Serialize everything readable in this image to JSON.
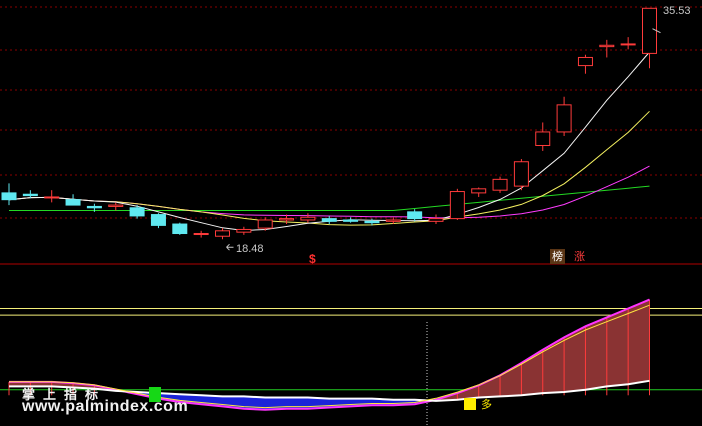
{
  "chart_data": [
    {
      "type": "candlestick",
      "panel": "main",
      "annotations": {
        "high_label": "35.53",
        "low_label": "18.48",
        "marker": "$"
      },
      "candles": [
        {
          "o": 21.9,
          "h": 22.6,
          "l": 21.0,
          "c": 21.4
        },
        {
          "o": 21.8,
          "h": 22.1,
          "l": 21.5,
          "c": 21.7
        },
        {
          "o": 21.6,
          "h": 22.1,
          "l": 21.2,
          "c": 21.6
        },
        {
          "o": 21.4,
          "h": 21.8,
          "l": 21.0,
          "c": 21.0
        },
        {
          "o": 20.9,
          "h": 21.1,
          "l": 20.5,
          "c": 20.8
        },
        {
          "o": 20.9,
          "h": 21.2,
          "l": 20.6,
          "c": 21.0
        },
        {
          "o": 20.8,
          "h": 21.0,
          "l": 20.0,
          "c": 20.2
        },
        {
          "o": 20.3,
          "h": 20.4,
          "l": 19.3,
          "c": 19.5
        },
        {
          "o": 19.6,
          "h": 19.7,
          "l": 18.8,
          "c": 18.9
        },
        {
          "o": 18.9,
          "h": 19.1,
          "l": 18.6,
          "c": 18.9
        },
        {
          "o": 18.7,
          "h": 19.3,
          "l": 18.48,
          "c": 19.1
        },
        {
          "o": 19.0,
          "h": 19.4,
          "l": 18.8,
          "c": 19.2
        },
        {
          "o": 19.3,
          "h": 20.1,
          "l": 19.1,
          "c": 19.9
        },
        {
          "o": 19.9,
          "h": 20.3,
          "l": 19.6,
          "c": 20.0
        },
        {
          "o": 19.9,
          "h": 20.4,
          "l": 19.7,
          "c": 20.1
        },
        {
          "o": 20.0,
          "h": 20.2,
          "l": 19.6,
          "c": 19.8
        },
        {
          "o": 19.9,
          "h": 20.1,
          "l": 19.7,
          "c": 19.8
        },
        {
          "o": 19.8,
          "h": 20.0,
          "l": 19.5,
          "c": 19.7
        },
        {
          "o": 19.8,
          "h": 20.1,
          "l": 19.6,
          "c": 19.9
        },
        {
          "o": 20.5,
          "h": 20.7,
          "l": 19.8,
          "c": 20.0
        },
        {
          "o": 19.8,
          "h": 20.3,
          "l": 19.6,
          "c": 20.0
        },
        {
          "o": 20.0,
          "h": 22.2,
          "l": 19.9,
          "c": 22.0
        },
        {
          "o": 21.9,
          "h": 22.3,
          "l": 21.6,
          "c": 22.2
        },
        {
          "o": 22.1,
          "h": 23.1,
          "l": 21.9,
          "c": 22.9
        },
        {
          "o": 22.4,
          "h": 24.4,
          "l": 22.1,
          "c": 24.2
        },
        {
          "o": 25.4,
          "h": 27.1,
          "l": 25.0,
          "c": 26.4
        },
        {
          "o": 26.4,
          "h": 29.0,
          "l": 26.1,
          "c": 28.4
        },
        {
          "o": 31.3,
          "h": 32.1,
          "l": 30.7,
          "c": 31.9
        },
        {
          "o": 32.7,
          "h": 33.2,
          "l": 31.9,
          "c": 32.8
        },
        {
          "o": 32.9,
          "h": 33.4,
          "l": 32.5,
          "c": 32.9
        },
        {
          "o": 32.2,
          "h": 34.1,
          "l": 31.1,
          "c": 35.53
        }
      ]
    },
    {
      "type": "area",
      "panel": "indicator",
      "levels": [
        0.78,
        0.72,
        0.05
      ],
      "series": [
        {
          "values": [
            0.12,
            0.12,
            0.12,
            0.11,
            0.09,
            0.05,
            0.01,
            -0.03,
            -0.06,
            -0.08,
            -0.1,
            -0.12,
            -0.13,
            -0.12,
            -0.12,
            -0.11,
            -0.1,
            -0.09,
            -0.09,
            -0.08,
            -0.04,
            0.02,
            0.09,
            0.18,
            0.29,
            0.41,
            0.52,
            0.62,
            0.7,
            0.78,
            0.86
          ]
        },
        {
          "values": [
            0.08,
            0.08,
            0.08,
            0.07,
            0.06,
            0.04,
            0.03,
            0.02,
            0.01,
            0.0,
            -0.01,
            -0.01,
            -0.02,
            -0.02,
            -0.02,
            -0.03,
            -0.03,
            -0.03,
            -0.04,
            -0.04,
            -0.05,
            -0.04,
            -0.02,
            -0.01,
            0.0,
            0.02,
            0.03,
            0.05,
            0.08,
            0.1,
            0.13
          ]
        },
        {
          "values": [
            0.79,
            0.8,
            0.8,
            0.81,
            0.81,
            0.82,
            0.82,
            0.83,
            0.83,
            0.84,
            0.84,
            0.85,
            0.85,
            0.86,
            0.86,
            0.87,
            0.87,
            0.88,
            0.88,
            0.89,
            0.89,
            0.9,
            0.9,
            0.91,
            0.91,
            0.92,
            0.92,
            0.93,
            0.93,
            0.94,
            0.94
          ]
        }
      ]
    }
  ],
  "badges": [
    {
      "text": "榜",
      "color": "#ffffff",
      "bg": "#5a3515"
    },
    {
      "text": "涨",
      "color": "#ff3c3c",
      "bg": "#000000"
    }
  ],
  "watermark": {
    "line1": "掌上指标",
    "line2": "www.palmindex.com"
  },
  "signal": {
    "text": "多"
  },
  "colors": {
    "up": "#ff3b3b",
    "down": "#5fe8f0",
    "ma5": "#f4f4f4",
    "ma10": "#f4f060",
    "ma20": "#ff3cff",
    "ma60": "#23d923",
    "grid": "#8a0000"
  }
}
